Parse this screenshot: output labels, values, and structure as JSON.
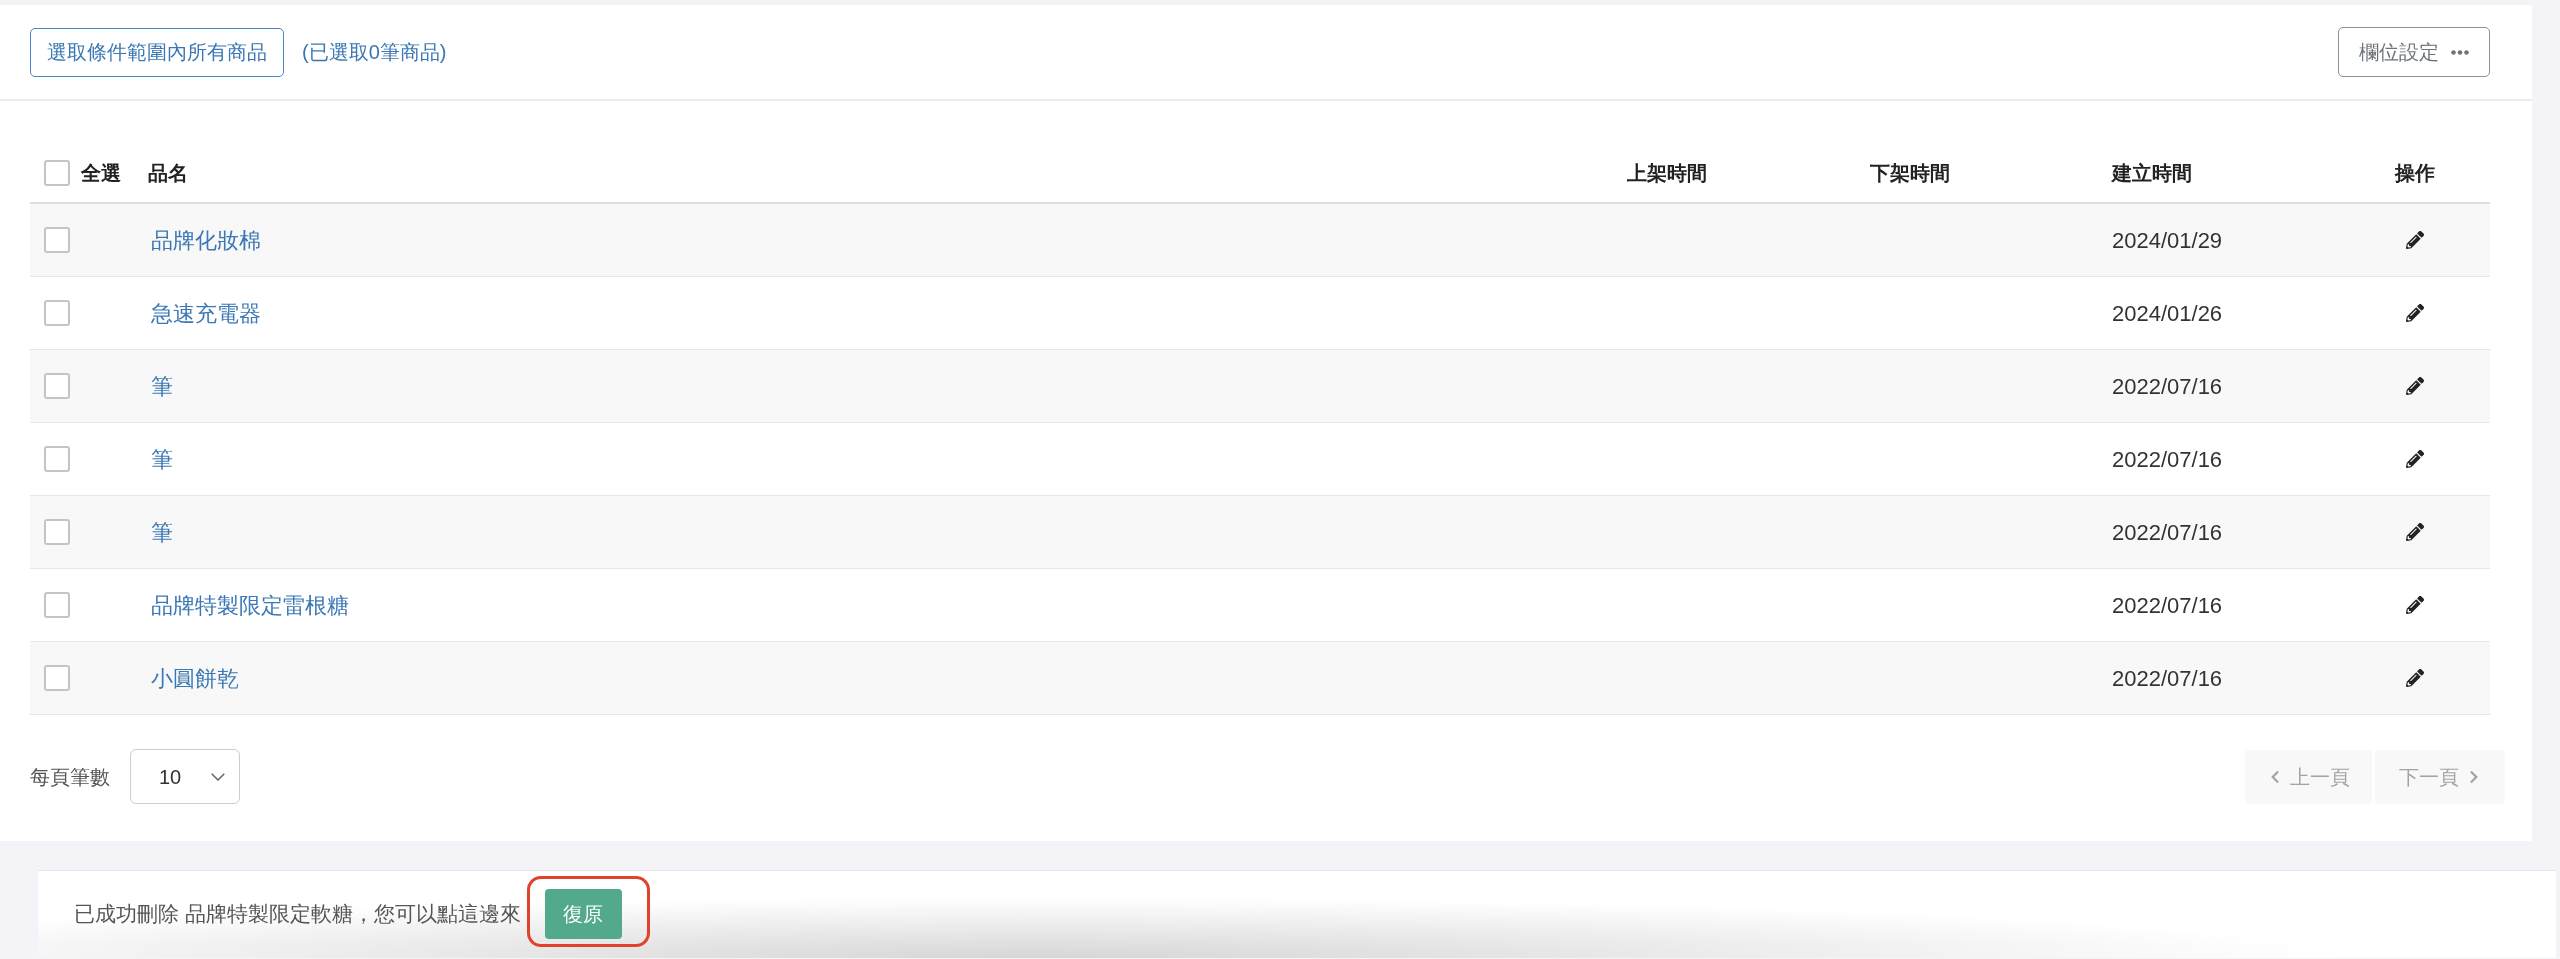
{
  "toolbar": {
    "select_all_button": "選取條件範圍內所有商品",
    "selected_count": "(已選取0筆商品)",
    "column_settings_button": "欄位設定"
  },
  "table": {
    "select_all": {
      "label": "全選",
      "checked": false
    },
    "columns": [
      "品名",
      "上架時間",
      "下架時間",
      "建立時間",
      "操作"
    ],
    "rows": [
      {
        "checked": false,
        "name": "品牌化妝棉",
        "created": "2024/01/29"
      },
      {
        "checked": false,
        "name": "急速充電器",
        "created": "2024/01/26"
      },
      {
        "checked": false,
        "name": "筆",
        "created": "2022/07/16"
      },
      {
        "checked": false,
        "name": "筆",
        "created": "2022/07/16"
      },
      {
        "checked": false,
        "name": "筆",
        "created": "2022/07/16"
      },
      {
        "checked": false,
        "name": "品牌特製限定雷根糖",
        "created": "2022/07/16"
      },
      {
        "checked": false,
        "name": "小圓餅乾",
        "created": "2022/07/16"
      }
    ]
  },
  "pagination": {
    "page_size_label": "每頁筆數",
    "page_size": "10",
    "prev": {
      "label": "上一頁",
      "disabled": true
    },
    "next": {
      "label": "下一頁",
      "disabled": true
    }
  },
  "toast": {
    "message": "已成功刪除 品牌特製限定軟糖，您可以點這邊來",
    "restore_button": {
      "label": "復原",
      "highlighted": true
    }
  }
}
